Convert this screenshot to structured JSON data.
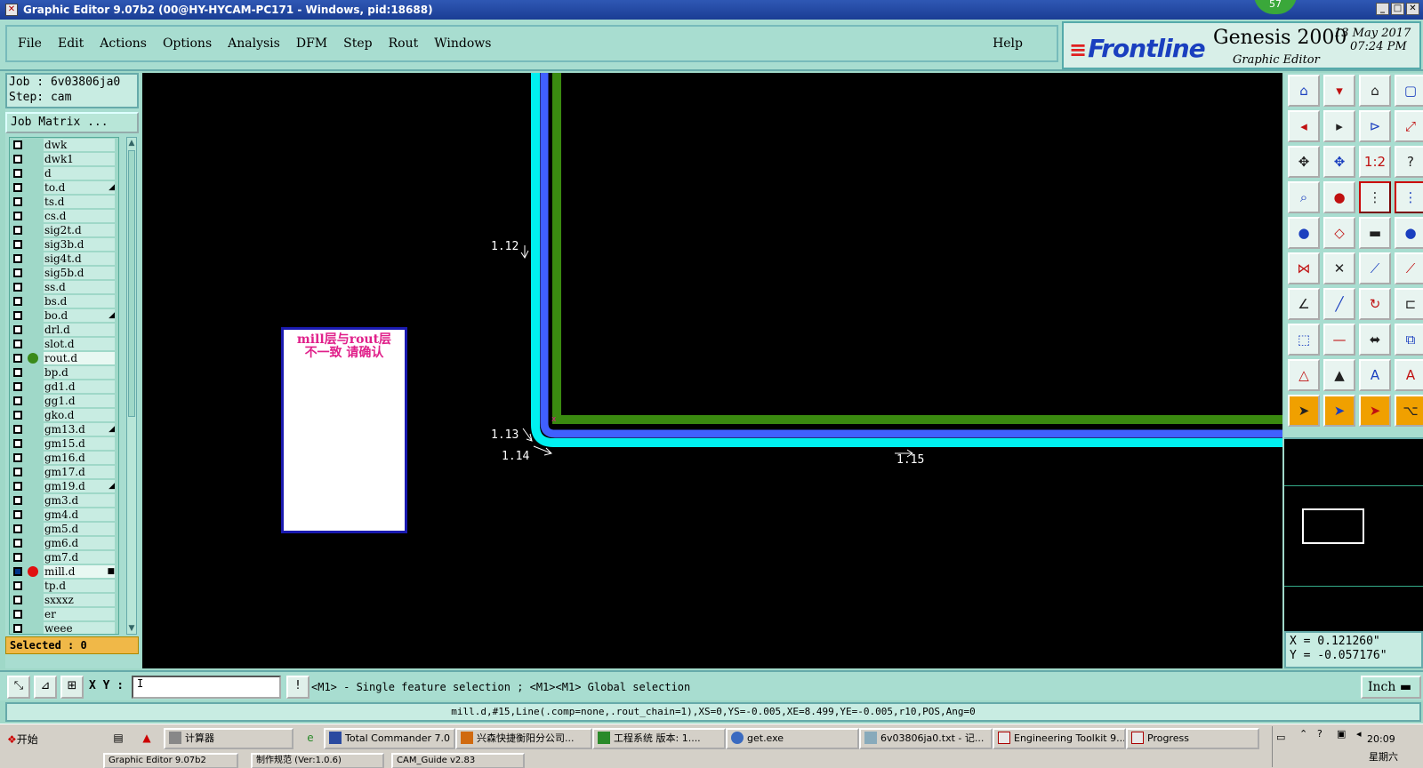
{
  "window": {
    "title": "Graphic Editor 9.07b2 (00@HY-HYCAM-PC171 - Windows, pid:18688)",
    "badge": "57"
  },
  "menu": {
    "items": [
      "File",
      "Edit",
      "Actions",
      "Options",
      "Analysis",
      "DFM",
      "Step",
      "Rout",
      "Windows"
    ],
    "help": "Help"
  },
  "brand": {
    "logo": "Frontline",
    "product": "Genesis 2000",
    "subtitle": "Graphic Editor",
    "date": "13 May 2017",
    "time": "07:24 PM"
  },
  "left": {
    "job": "Job : 6v03806ja0",
    "step": "Step: cam",
    "job_matrix": "Job Matrix ...",
    "selected": "Selected : 0",
    "layers": [
      {
        "name": "dwk",
        "dot": "",
        "mark": ""
      },
      {
        "name": "dwk1",
        "dot": "",
        "mark": ""
      },
      {
        "name": "d",
        "dot": "",
        "mark": ""
      },
      {
        "name": "to.d",
        "dot": "",
        "mark": "◢"
      },
      {
        "name": "ts.d",
        "dot": "",
        "mark": ""
      },
      {
        "name": "cs.d",
        "dot": "",
        "mark": ""
      },
      {
        "name": "sig2t.d",
        "dot": "",
        "mark": ""
      },
      {
        "name": "sig3b.d",
        "dot": "",
        "mark": ""
      },
      {
        "name": "sig4t.d",
        "dot": "",
        "mark": ""
      },
      {
        "name": "sig5b.d",
        "dot": "",
        "mark": ""
      },
      {
        "name": "ss.d",
        "dot": "",
        "mark": ""
      },
      {
        "name": "bs.d",
        "dot": "",
        "mark": ""
      },
      {
        "name": "bo.d",
        "dot": "",
        "mark": "◢"
      },
      {
        "name": "drl.d",
        "dot": "",
        "mark": ""
      },
      {
        "name": "slot.d",
        "dot": "",
        "mark": ""
      },
      {
        "name": "rout.d",
        "dot": "#3a8a1a",
        "mark": ""
      },
      {
        "name": "bp.d",
        "dot": "",
        "mark": ""
      },
      {
        "name": "gd1.d",
        "dot": "",
        "mark": ""
      },
      {
        "name": "gg1.d",
        "dot": "",
        "mark": ""
      },
      {
        "name": "gko.d",
        "dot": "",
        "mark": ""
      },
      {
        "name": "gm13.d",
        "dot": "",
        "mark": "◢"
      },
      {
        "name": "gm15.d",
        "dot": "",
        "mark": ""
      },
      {
        "name": "gm16.d",
        "dot": "",
        "mark": ""
      },
      {
        "name": "gm17.d",
        "dot": "",
        "mark": ""
      },
      {
        "name": "gm19.d",
        "dot": "",
        "mark": "◢"
      },
      {
        "name": "gm3.d",
        "dot": "",
        "mark": ""
      },
      {
        "name": "gm4.d",
        "dot": "",
        "mark": ""
      },
      {
        "name": "gm5.d",
        "dot": "",
        "mark": ""
      },
      {
        "name": "gm6.d",
        "dot": "",
        "mark": ""
      },
      {
        "name": "gm7.d",
        "dot": "",
        "mark": ""
      },
      {
        "name": "mill.d",
        "dot": "#e01010",
        "mark": "■",
        "checked": true
      },
      {
        "name": "tp.d",
        "dot": "",
        "mark": ""
      },
      {
        "name": "sxxxz",
        "dot": "",
        "mark": ""
      },
      {
        "name": "er",
        "dot": "",
        "mark": ""
      },
      {
        "name": "weee",
        "dot": "",
        "mark": ""
      }
    ]
  },
  "canvas": {
    "note_line1": "mill层与rout层",
    "note_line2": "不一致 请确认",
    "labels": [
      "1.12",
      "1.13",
      "1.14",
      "1.15"
    ],
    "colors": {
      "cyan": "#00f0f0",
      "blue": "#4060ff",
      "green": "#3a8a10",
      "note": "#e0208a"
    }
  },
  "coords": {
    "x": "X =  0.121260\"",
    "y": "Y = -0.057176\""
  },
  "command": {
    "xy_label": "X Y :",
    "xy_value": "I",
    "prompt": "<M1> - Single feature selection ; <M1><M1> Global selection",
    "units": "Inch"
  },
  "feature_info": "mill.d,#15,Line(.comp=none,.rout_chain=1),XS=0,YS=-0.005,XE=8.499,YE=-0.005,r10,POS,Ang=0",
  "taskbar": {
    "start": "开始",
    "tasks": [
      "计算器",
      "Total Commander 7.0 ...",
      "兴森快捷衡阳分公司...",
      "工程系统  版本: 1....",
      "get.exe",
      "6v03806ja0.txt - 记...",
      "Engineering Toolkit 9....",
      "Progress"
    ],
    "tasks_row2": [
      "Graphic Editor 9.07b2",
      "制作规范 (Ver:1.0.6)",
      "CAM_Guide v2.83"
    ],
    "clock": "20:09",
    "weekday": "星期六"
  }
}
